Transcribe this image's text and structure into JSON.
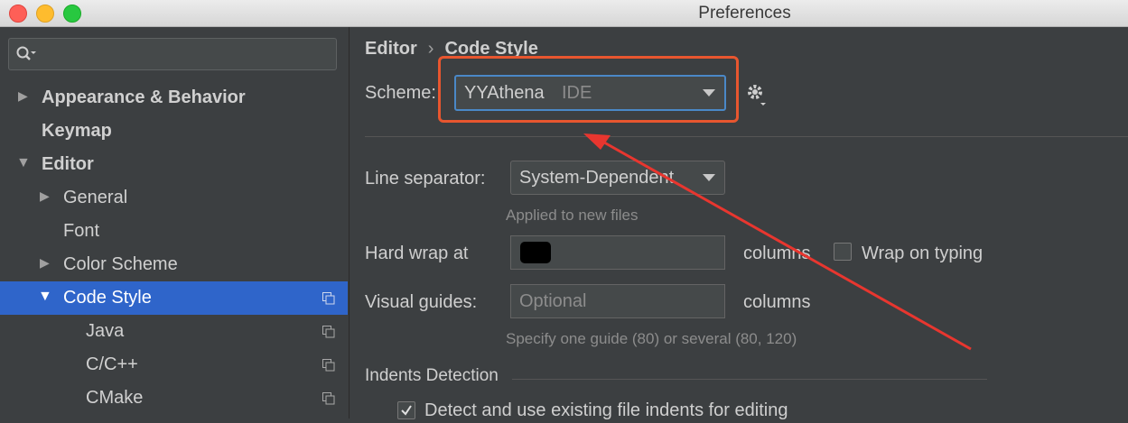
{
  "window": {
    "title": "Preferences"
  },
  "sidebar": {
    "search": {
      "placeholder": ""
    },
    "items": [
      {
        "label": "Appearance & Behavior"
      },
      {
        "label": "Keymap"
      },
      {
        "label": "Editor"
      },
      {
        "label": "General"
      },
      {
        "label": "Font"
      },
      {
        "label": "Color Scheme"
      },
      {
        "label": "Code Style"
      },
      {
        "label": "Java"
      },
      {
        "label": "C/C++"
      },
      {
        "label": "CMake"
      }
    ],
    "selected": "Code Style"
  },
  "breadcrumb": {
    "part1": "Editor",
    "separator": "›",
    "part2": "Code Style"
  },
  "scheme": {
    "label": "Scheme:",
    "value": "YYAthena",
    "tag": "IDE"
  },
  "line_separator": {
    "label": "Line separator:",
    "value": "System-Dependent",
    "hint": "Applied to new files"
  },
  "hard_wrap": {
    "label": "Hard wrap at",
    "value": "",
    "units": "columns",
    "wrap_on_typing": "Wrap on typing"
  },
  "visual_guides": {
    "label": "Visual guides:",
    "placeholder": "Optional",
    "units": "columns",
    "hint": "Specify one guide (80) or several (80, 120)"
  },
  "indents": {
    "section": "Indents Detection",
    "detect_label": "Detect and use existing file indents for editing"
  },
  "colors": {
    "accent": "#2f65ca",
    "annotation": "#e8562f"
  }
}
